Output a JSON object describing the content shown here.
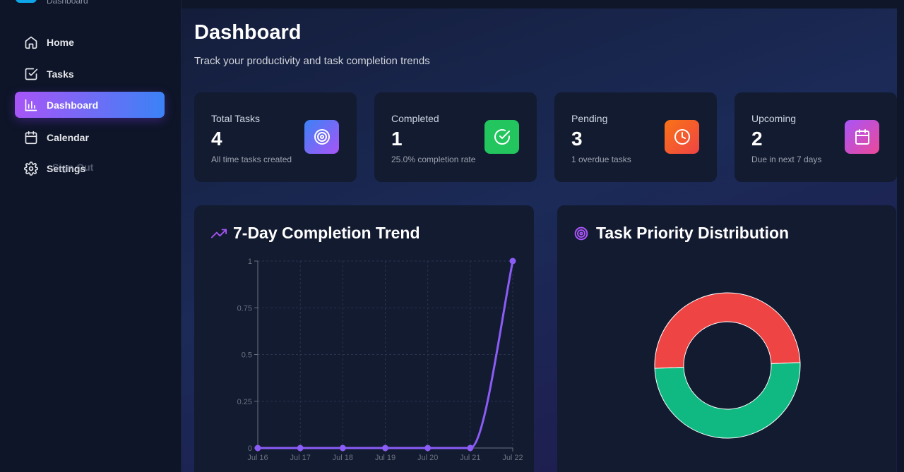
{
  "sidebar": {
    "brand_subtitle": "Dashboard",
    "items": [
      {
        "label": "Home",
        "icon": "home-icon"
      },
      {
        "label": "Tasks",
        "icon": "checkbox-icon"
      },
      {
        "label": "Dashboard",
        "icon": "bar-chart-icon",
        "active": true
      },
      {
        "label": "Calendar",
        "icon": "calendar-icon"
      },
      {
        "label": "Settings",
        "icon": "gear-icon"
      }
    ],
    "sign_out": "Sign Out"
  },
  "header": {
    "title": "Dashboard",
    "subtitle": "Track your productivity and task completion trends"
  },
  "stats": [
    {
      "label": "Total Tasks",
      "value": "4",
      "note": "All time tasks created",
      "icon": "target-icon",
      "color": "#6366f1"
    },
    {
      "label": "Completed",
      "value": "1",
      "note": "25.0% completion rate",
      "icon": "check-circle-icon",
      "color": "#22c55e"
    },
    {
      "label": "Pending",
      "value": "3",
      "note": "1 overdue tasks",
      "icon": "clock-icon",
      "color": "#f97316"
    },
    {
      "label": "Upcoming",
      "value": "2",
      "note": "Due in next 7 days",
      "icon": "calendar-icon",
      "color": "#d946ef"
    }
  ],
  "trend_panel": {
    "title": "7-Day Completion Trend",
    "icon": "trending-up-icon"
  },
  "priority_panel": {
    "title": "Task Priority Distribution",
    "icon": "target-icon"
  },
  "chart_data": [
    {
      "type": "line",
      "title": "7-Day Completion Trend",
      "x": [
        "Jul 16",
        "Jul 17",
        "Jul 18",
        "Jul 19",
        "Jul 20",
        "Jul 21",
        "Jul 22"
      ],
      "series": [
        {
          "values": [
            0,
            0,
            0,
            0,
            0,
            0,
            1
          ],
          "color": "#8b5cf6"
        }
      ],
      "yticks": [
        "0",
        "0.25",
        "0.5",
        "0.75",
        "1"
      ],
      "ylim": [
        0,
        1
      ],
      "grid": true
    },
    {
      "type": "pie",
      "title": "Task Priority Distribution",
      "donut": true,
      "slices": [
        {
          "value": 2,
          "color": "#ef4444"
        },
        {
          "value": 2,
          "color": "#10b981"
        }
      ]
    }
  ]
}
